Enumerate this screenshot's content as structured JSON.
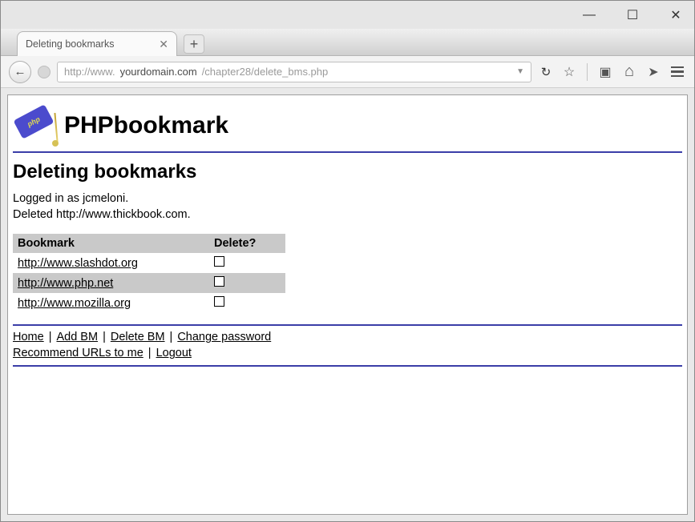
{
  "window": {
    "min": "—",
    "max": "☐",
    "close": "✕"
  },
  "tab": {
    "title": "Deleting bookmarks",
    "close": "✕",
    "newtab": "+"
  },
  "address": {
    "back": "←",
    "url_prefix": "http://www.",
    "url_domain": "yourdomain.com",
    "url_path": "/chapter28/delete_bms.php",
    "dropdown": "▼",
    "reload": "↻"
  },
  "toolbar": {
    "star": "☆",
    "clipboard": "▣",
    "home": "⌂",
    "send": "➤"
  },
  "logo": {
    "text": "PHPbookmark",
    "tag_text": "php"
  },
  "page": {
    "title": "Deleting bookmarks",
    "logged_in": "Logged in as jcmeloni.",
    "deleted": "Deleted http://www.thickbook.com."
  },
  "table": {
    "headers": {
      "bookmark": "Bookmark",
      "delete": "Delete?"
    },
    "rows": [
      {
        "url": "http://www.slashdot.org",
        "checked": false
      },
      {
        "url": "http://www.php.net",
        "checked": false
      },
      {
        "url": "http://www.mozilla.org",
        "checked": false
      }
    ]
  },
  "footer": {
    "home": "Home",
    "add_bm": "Add BM",
    "delete_bm": "Delete BM",
    "change_pw": "Change password",
    "recommend": "Recommend URLs to me",
    "logout": "Logout",
    "sep": "|"
  }
}
